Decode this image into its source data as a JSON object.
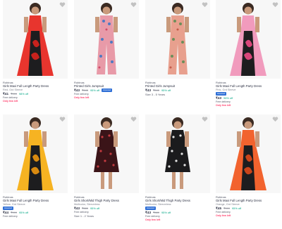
{
  "products": [
    {
      "brand": "Robinas",
      "title": "Girls Maxi Full Length Party Dress",
      "sub": "Red, Grd Sleeve",
      "badge": "",
      "price": "₹41",
      "mrp": "₹999",
      "off": "98% off",
      "delivery": "Free delivery",
      "stock": "Only few left",
      "size": ""
    },
    {
      "brand": "Robinas",
      "title": "Printed Girls Jumpsuit",
      "sub": "",
      "badge": "Assured",
      "price": "₹43",
      "mrp": "₹845",
      "off": "95% off",
      "delivery": "Free delivery",
      "stock": "Only few left",
      "size": ""
    },
    {
      "brand": "Robinas",
      "title": "Printed Girls Jumpsuit",
      "sub": "",
      "badge": "",
      "price": "₹43",
      "mrp": "₹845",
      "off": "95% off",
      "delivery": "",
      "stock": "",
      "size": "Size 3 - 5 Years"
    },
    {
      "brand": "Robinas",
      "title": "Girls Maxi Full Length Party Dress",
      "sub": "Pink, Grd Sleeve",
      "badge": "Assured",
      "price": "₹43",
      "mrp": "",
      "off": "96% off",
      "delivery": "Free delivery",
      "stock": "Only few left",
      "size": ""
    },
    {
      "brand": "Robinas",
      "title": "Girls Maxi Full Length Party Dress",
      "sub": "Yellow, Grd Sleeve",
      "badge": "Assured",
      "price": "₹44",
      "mrp": "₹999",
      "off": "95% off",
      "delivery": "Free delivery",
      "stock": "",
      "size": ""
    },
    {
      "brand": "Robinas",
      "title": "Girls Short/Mid Thigh Party Dress",
      "sub": "Multicolor, Sleeveless",
      "badge": "",
      "price": "₹43",
      "mrp": "₹880",
      "off": "95% off",
      "delivery": "Free delivery",
      "stock": "",
      "size": "Size 1 - 2 Years"
    },
    {
      "brand": "Robinas",
      "title": "Girls Short/Mid Thigh Party Dress",
      "sub": "Multicolor, Sleeveless",
      "badge": "Assured",
      "price": "₹43",
      "mrp": "₹880",
      "off": "95% off",
      "delivery": "Free delivery",
      "stock": "Only few left",
      "size": ""
    },
    {
      "brand": "Robinas",
      "title": "Girls Maxi Full Length Party Dress",
      "sub": "Orange, Grd Sleeve",
      "badge": "",
      "price": "₹45",
      "mrp": "₹999",
      "off": "95% off",
      "delivery": "Free delivery",
      "stock": "Only few left",
      "size": ""
    }
  ]
}
